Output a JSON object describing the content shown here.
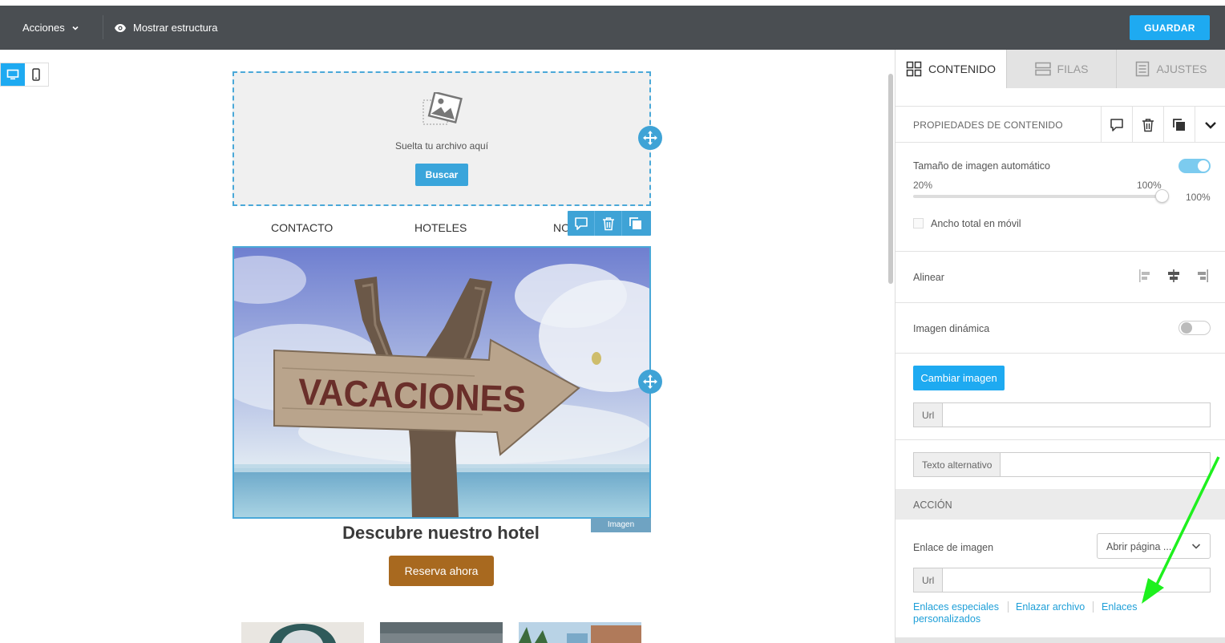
{
  "topbar": {
    "acciones_label": "Acciones",
    "mostrar_label": "Mostrar estructura",
    "guardar_label": "GUARDAR"
  },
  "canvas": {
    "dropzone": {
      "text": "Suelta tu archivo aquí",
      "button": "Buscar"
    },
    "nav": [
      "CONTACTO",
      "HOTELES",
      "NO"
    ],
    "hero": {
      "sign_text": "VACACIONES",
      "tag": "Imagen"
    },
    "headline": "Descubre nuestro hotel",
    "cta": "Reserva ahora"
  },
  "panel": {
    "tabs": [
      {
        "label": "CONTENIDO",
        "active": true
      },
      {
        "label": "FILAS",
        "active": false
      },
      {
        "label": "AJUSTES",
        "active": false
      }
    ],
    "props_title": "PROPIEDADES DE CONTENIDO",
    "auto_size": {
      "label": "Tamaño de imagen automático",
      "enabled": true
    },
    "slider": {
      "min_label": "20%",
      "max_label": "100%",
      "value_label": "100%",
      "value": 100
    },
    "full_width_mobile": {
      "label": "Ancho total en móvil",
      "checked": false
    },
    "align_label": "Alinear",
    "dynamic_image": {
      "label": "Imagen dinámica",
      "enabled": false
    },
    "change_image_button": "Cambiar imagen",
    "url_addon": "Url",
    "alt_addon": "Texto alternativo",
    "action_section": "ACCIÓN",
    "image_link": {
      "label": "Enlace de imagen",
      "selected": "Abrir página ..."
    },
    "link_url_addon": "Url",
    "links": {
      "special": "Enlaces especiales",
      "file": "Enlazar archivo",
      "custom_line1": "Enlaces",
      "custom_line2": "personalizados"
    }
  },
  "colors": {
    "accent": "#1eaaf1",
    "cta": "#a8691f",
    "topbar": "#4a4e52"
  }
}
